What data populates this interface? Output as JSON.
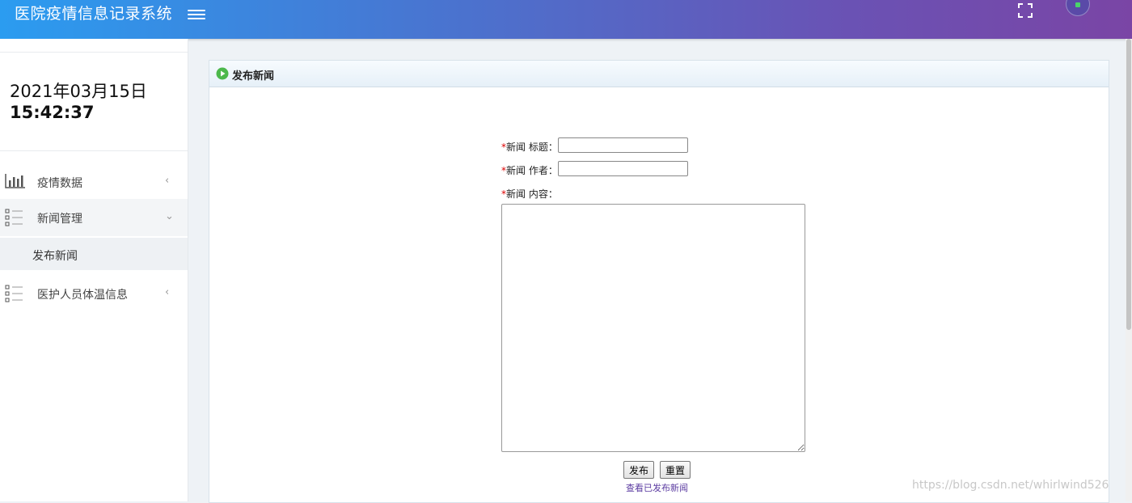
{
  "header": {
    "app_title": "医院疫情信息记录系统",
    "icons": {
      "menu": "hamburger-menu-icon",
      "fullscreen": "fullscreen-icon",
      "avatar": "user-avatar"
    }
  },
  "sidebar": {
    "date": "2021年03月15日",
    "time": "15:42:37",
    "items": [
      {
        "label": "疫情数据",
        "icon": "bar-chart-icon",
        "expanded": false
      },
      {
        "label": "新闻管理",
        "icon": "list-icon",
        "expanded": true,
        "children": [
          {
            "label": "发布新闻"
          }
        ]
      },
      {
        "label": "医护人员体温信息",
        "icon": "list-icon",
        "expanded": false
      }
    ]
  },
  "panel": {
    "title": "发布新闻",
    "form": {
      "title_label": "新闻 标题：",
      "title_value": "",
      "author_label": "新闻 作者：",
      "author_value": "",
      "content_label": "新闻 内容：",
      "content_value": "",
      "required_mark": "*"
    },
    "buttons": {
      "publish": "发布",
      "reset": "重置"
    },
    "view_link": "查看已发布新闻"
  },
  "watermark": "https://blog.csdn.net/whirlwind526",
  "colors": {
    "header_start": "#2b9cf0",
    "header_end": "#7a45a5",
    "required": "#dd0000",
    "link": "#5a3aa0"
  }
}
